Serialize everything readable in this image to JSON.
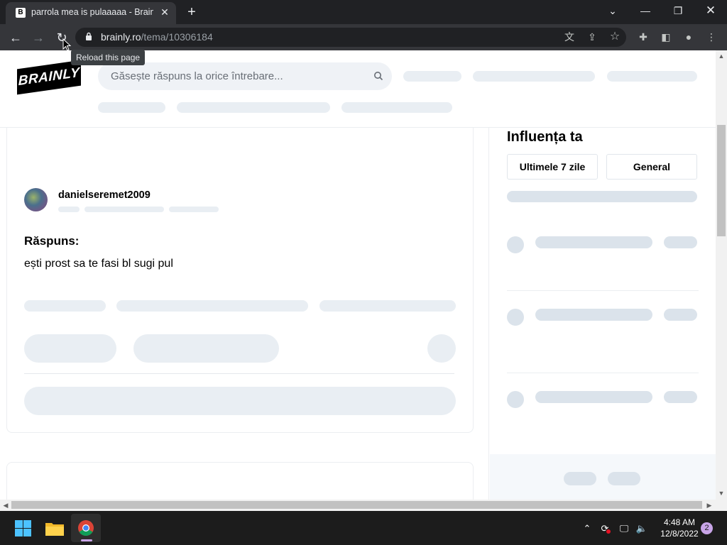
{
  "browser": {
    "tab_title": "parrola mea is pulaaaaa - Brainly",
    "tab_favicon": "B",
    "url_domain": "brainly.ro",
    "url_path": "/tema/10306184",
    "tooltip": "Reload this page"
  },
  "page": {
    "logo": "BRAINLY",
    "search_placeholder": "Găsește răspuns la orice întrebare...",
    "username": "danielseremet2009",
    "answer_label": "Răspuns:",
    "answer_text": "ești prost sa te fasi bl sugi pul"
  },
  "sidebar": {
    "title": "Influența ta",
    "tabs": [
      "Ultimele 7 zile",
      "General"
    ]
  },
  "taskbar": {
    "time": "4:48 AM",
    "date": "12/8/2022",
    "notification_count": "2"
  },
  "colors": {
    "skeleton": "#e9eef3",
    "skeleton_dark": "#dbe3eb",
    "chrome_dark": "#202124"
  }
}
